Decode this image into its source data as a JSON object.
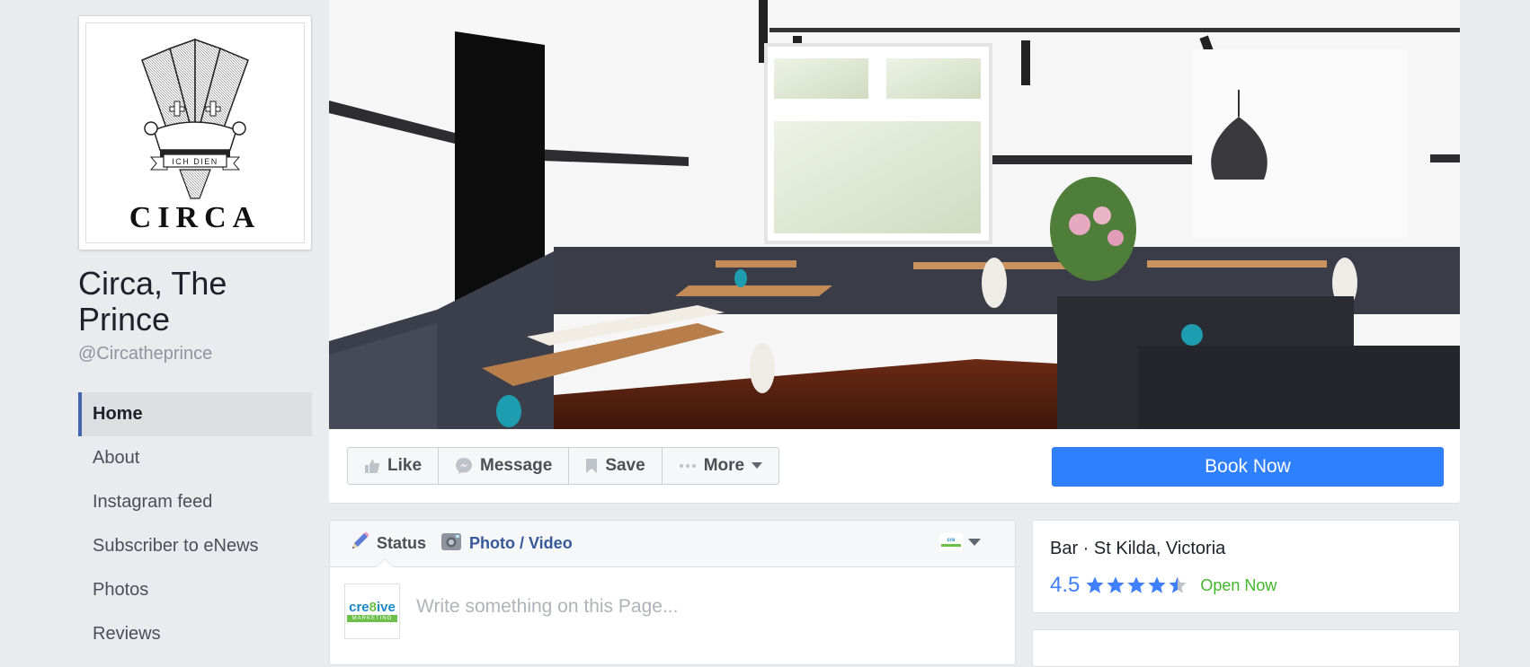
{
  "page": {
    "name": "Circa, The Prince",
    "handle": "@Circatheprince",
    "logo_text": "CIRCA",
    "logo_motto": "ICH DIEN"
  },
  "sidebar": {
    "items": [
      {
        "label": "Home",
        "active": true
      },
      {
        "label": "About",
        "active": false
      },
      {
        "label": "Instagram feed",
        "active": false
      },
      {
        "label": "Subscriber to eNews",
        "active": false
      },
      {
        "label": "Photos",
        "active": false
      },
      {
        "label": "Reviews",
        "active": false
      }
    ]
  },
  "cover": {
    "description": "Restaurant interior cover photo"
  },
  "actions": {
    "like": "Like",
    "message": "Message",
    "save": "Save",
    "more": "More",
    "book_now": "Book Now"
  },
  "composer": {
    "status_tab": "Status",
    "photo_tab": "Photo / Video",
    "placeholder": "Write something on this Page...",
    "avatar_text_a": "cre",
    "avatar_text_b": "8",
    "avatar_text_c": "ive",
    "avatar_subtext": "MARKETING"
  },
  "info": {
    "category": "Bar · St Kilda, Victoria",
    "rating": "4.5",
    "rating_value": 4.5,
    "rating_max": 5,
    "open_status": "Open Now"
  },
  "colors": {
    "background": "#e9ebee",
    "accent_blue": "#4267b2",
    "book_now": "#2f80ff",
    "rating_blue": "#4080ff",
    "open_green": "#42b72a",
    "link_blue": "#365899"
  }
}
